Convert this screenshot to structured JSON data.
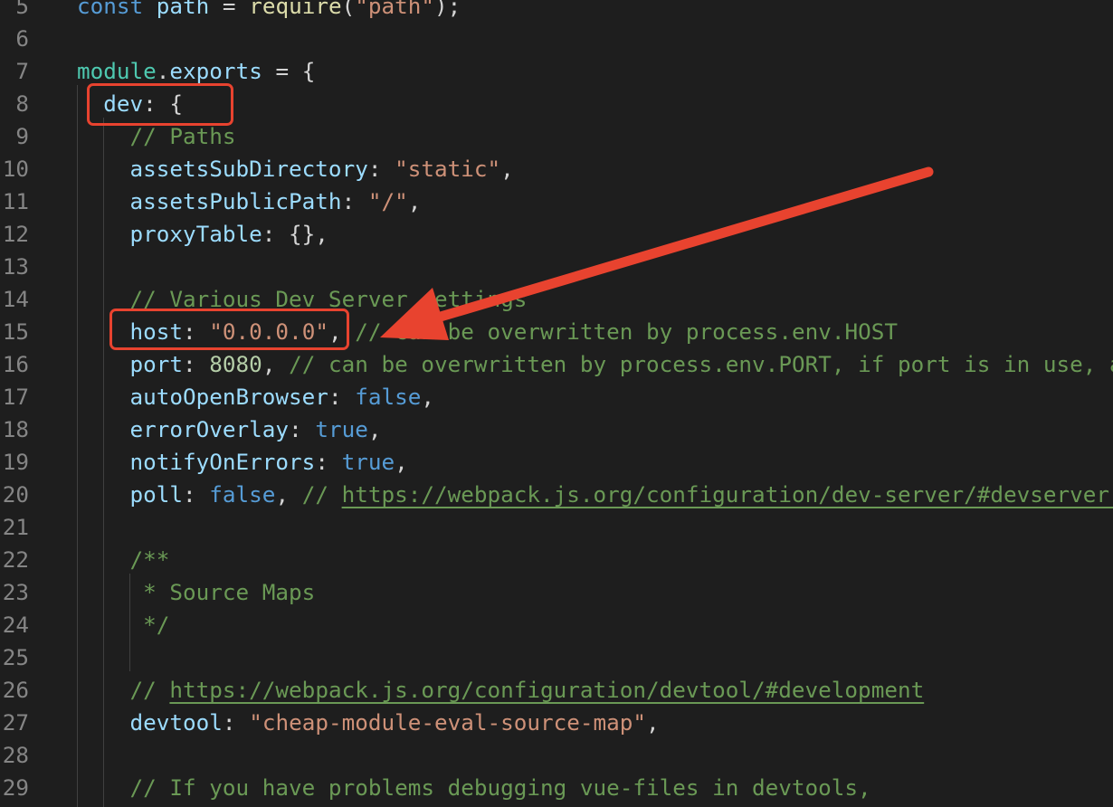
{
  "editor": {
    "lines": [
      {
        "number": "5",
        "tokens": [
          [
            "kw",
            "const "
          ],
          [
            "var",
            "path"
          ],
          [
            "punc",
            " = "
          ],
          [
            "fn",
            "require"
          ],
          [
            "punc",
            "("
          ],
          [
            "str",
            "\"path\""
          ],
          [
            "punc",
            ");"
          ]
        ]
      },
      {
        "number": "6",
        "tokens": []
      },
      {
        "number": "7",
        "tokens": [
          [
            "obj",
            "module"
          ],
          [
            "punc",
            "."
          ],
          [
            "var",
            "exports"
          ],
          [
            "punc",
            " = {"
          ]
        ]
      },
      {
        "number": "8",
        "tokens": [
          [
            "punc",
            "  "
          ],
          [
            "prop",
            "dev"
          ],
          [
            "punc",
            ": {"
          ]
        ]
      },
      {
        "number": "9",
        "tokens": [
          [
            "punc",
            "    "
          ],
          [
            "cm",
            "// Paths"
          ]
        ]
      },
      {
        "number": "10",
        "tokens": [
          [
            "punc",
            "    "
          ],
          [
            "prop",
            "assetsSubDirectory"
          ],
          [
            "punc",
            ": "
          ],
          [
            "str",
            "\"static\""
          ],
          [
            "punc",
            ","
          ]
        ]
      },
      {
        "number": "11",
        "tokens": [
          [
            "punc",
            "    "
          ],
          [
            "prop",
            "assetsPublicPath"
          ],
          [
            "punc",
            ": "
          ],
          [
            "str",
            "\"/\""
          ],
          [
            "punc",
            ","
          ]
        ]
      },
      {
        "number": "12",
        "tokens": [
          [
            "punc",
            "    "
          ],
          [
            "prop",
            "proxyTable"
          ],
          [
            "punc",
            ": {},"
          ]
        ]
      },
      {
        "number": "13",
        "tokens": []
      },
      {
        "number": "14",
        "tokens": [
          [
            "punc",
            "    "
          ],
          [
            "cm",
            "// Various Dev Server settings"
          ]
        ]
      },
      {
        "number": "15",
        "tokens": [
          [
            "punc",
            "    "
          ],
          [
            "prop",
            "host"
          ],
          [
            "punc",
            ": "
          ],
          [
            "str",
            "\"0.0.0.0\""
          ],
          [
            "punc",
            ", "
          ],
          [
            "cm",
            "// can be overwritten by process.env.HOST"
          ]
        ]
      },
      {
        "number": "16",
        "tokens": [
          [
            "punc",
            "    "
          ],
          [
            "prop",
            "port"
          ],
          [
            "punc",
            ": "
          ],
          [
            "num",
            "8080"
          ],
          [
            "punc",
            ", "
          ],
          [
            "cm",
            "// can be overwritten by process.env.PORT, if port is in use, a free one will be determined"
          ]
        ]
      },
      {
        "number": "17",
        "tokens": [
          [
            "punc",
            "    "
          ],
          [
            "prop",
            "autoOpenBrowser"
          ],
          [
            "punc",
            ": "
          ],
          [
            "kw",
            "false"
          ],
          [
            "punc",
            ","
          ]
        ]
      },
      {
        "number": "18",
        "tokens": [
          [
            "punc",
            "    "
          ],
          [
            "prop",
            "errorOverlay"
          ],
          [
            "punc",
            ": "
          ],
          [
            "kw",
            "true"
          ],
          [
            "punc",
            ","
          ]
        ]
      },
      {
        "number": "19",
        "tokens": [
          [
            "punc",
            "    "
          ],
          [
            "prop",
            "notifyOnErrors"
          ],
          [
            "punc",
            ": "
          ],
          [
            "kw",
            "true"
          ],
          [
            "punc",
            ","
          ]
        ]
      },
      {
        "number": "20",
        "tokens": [
          [
            "punc",
            "    "
          ],
          [
            "prop",
            "poll"
          ],
          [
            "punc",
            ": "
          ],
          [
            "kw",
            "false"
          ],
          [
            "punc",
            ", "
          ],
          [
            "cm",
            "// "
          ],
          [
            "link",
            "https://webpack.js.org/configuration/dev-server/#devserver-watchoptions-"
          ]
        ]
      },
      {
        "number": "21",
        "tokens": []
      },
      {
        "number": "22",
        "tokens": [
          [
            "punc",
            "    "
          ],
          [
            "cm",
            "/**"
          ]
        ]
      },
      {
        "number": "23",
        "tokens": [
          [
            "punc",
            "     "
          ],
          [
            "cm",
            "* Source Maps"
          ]
        ]
      },
      {
        "number": "24",
        "tokens": [
          [
            "punc",
            "     "
          ],
          [
            "cm",
            "*/"
          ]
        ]
      },
      {
        "number": "25",
        "tokens": []
      },
      {
        "number": "26",
        "tokens": [
          [
            "punc",
            "    "
          ],
          [
            "cm",
            "// "
          ],
          [
            "link",
            "https://webpack.js.org/configuration/devtool/#development"
          ]
        ]
      },
      {
        "number": "27",
        "tokens": [
          [
            "punc",
            "    "
          ],
          [
            "prop",
            "devtool"
          ],
          [
            "punc",
            ": "
          ],
          [
            "str",
            "\"cheap-module-eval-source-map\""
          ],
          [
            "punc",
            ","
          ]
        ]
      },
      {
        "number": "28",
        "tokens": []
      },
      {
        "number": "29",
        "tokens": [
          [
            "punc",
            "    "
          ],
          [
            "cm",
            "// If you have problems debugging vue-files in devtools,"
          ]
        ]
      }
    ]
  },
  "annotations": {
    "box_color": "#e8432f",
    "arrow_color": "#e8432f",
    "highlighted": [
      "dev: {",
      "host: \"0.0.0.0\","
    ]
  },
  "colors": {
    "background": "#1e1e1e",
    "keyword": "#569cd6",
    "property": "#9cdcfe",
    "string": "#ce9178",
    "number": "#b5cea8",
    "comment": "#6a9955",
    "function": "#dcdcaa",
    "object": "#4ec9b0",
    "line_number": "#858585"
  }
}
